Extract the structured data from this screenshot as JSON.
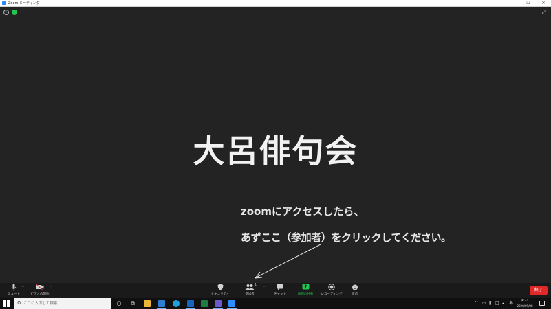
{
  "window": {
    "title": "Zoom ミーティング",
    "controls": {
      "minimize": "—",
      "maximize": "☐",
      "close": "✕"
    }
  },
  "meeting": {
    "title": "大呂俳句会",
    "instruction_line1": "zoomにアクセスしたら、",
    "instruction_line2": "あずここ（参加者）をクリックしてください。",
    "participant_count": "1",
    "info_symbol": "i",
    "fullscreen_symbol": "⤢"
  },
  "toolbar": {
    "mute_label": "ミュート",
    "video_label": "ビデオの開始",
    "security_label": "セキュリティ",
    "participants_label": "参加者",
    "chat_label": "チャット",
    "share_label": "画面の共有",
    "record_label": "レコーディング",
    "reactions_label": "反応",
    "end_label": "終了",
    "share_color": "#23c552",
    "end_color": "#e02828"
  },
  "taskbar": {
    "search_placeholder": "ここに入力して検索",
    "ime_indicator": "あ",
    "time": "9:21",
    "date": "2020/09/08"
  }
}
